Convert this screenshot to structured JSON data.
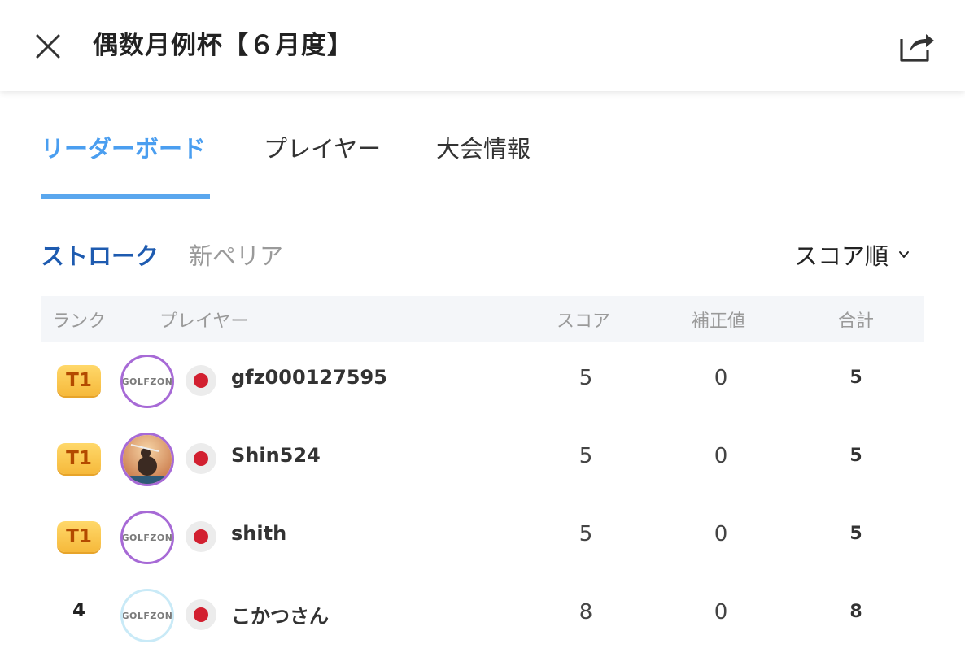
{
  "header": {
    "title": "偶数月例杯【６月度】"
  },
  "tabs": [
    {
      "label": "リーダーボード",
      "active": true
    },
    {
      "label": "プレイヤー",
      "active": false
    },
    {
      "label": "大会情報",
      "active": false
    }
  ],
  "subtabs": [
    {
      "label": "ストローク",
      "active": true
    },
    {
      "label": "新ペリア",
      "active": false
    }
  ],
  "sort": {
    "label": "スコア順"
  },
  "table": {
    "headers": {
      "rank": "ランク",
      "player": "プレイヤー",
      "score": "スコア",
      "adjust": "補正値",
      "total": "合計"
    },
    "rows": [
      {
        "rank": "T1",
        "tied": true,
        "avatar": "golfzon-logo",
        "avatar_text": "GOLFZON",
        "flag": "japan-flag",
        "name": "gfz000127595",
        "score": "5",
        "adjust": "0",
        "total": "5"
      },
      {
        "rank": "T1",
        "tied": true,
        "avatar": "golfer-photo",
        "avatar_text": "",
        "flag": "japan-flag",
        "name": "Shin524",
        "score": "5",
        "adjust": "0",
        "total": "5"
      },
      {
        "rank": "T1",
        "tied": true,
        "avatar": "golfzon-logo",
        "avatar_text": "GOLFZON",
        "flag": "japan-flag",
        "name": "shith",
        "score": "5",
        "adjust": "0",
        "total": "5"
      },
      {
        "rank": "4",
        "tied": false,
        "avatar": "golfzon-logo",
        "avatar_text": "GOLFZON",
        "flag": "japan-flag",
        "name": "こかつさん",
        "score": "8",
        "adjust": "0",
        "total": "8"
      }
    ]
  },
  "colors": {
    "accent": "#4a9ef0",
    "active_subtab": "#1e5bb0",
    "badge": "#f6b93b",
    "flag_red": "#d22030"
  }
}
